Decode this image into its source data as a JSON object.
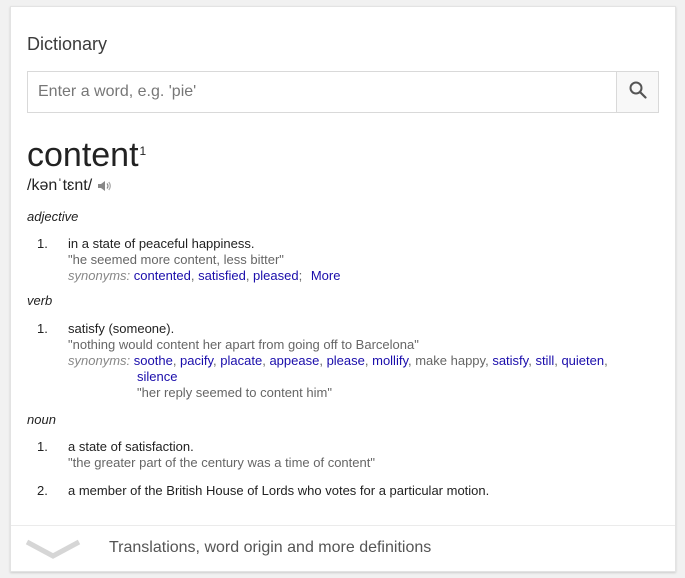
{
  "card": {
    "title": "Dictionary"
  },
  "search": {
    "placeholder": "Enter a word, e.g. 'pie'",
    "value": "",
    "icon": "search-icon"
  },
  "entry": {
    "word": "content",
    "superscript": "1",
    "pronunciation": "/kənˈtɛnt/",
    "speaker_icon": "speaker-icon"
  },
  "adjective": {
    "label": "adjective",
    "senses": [
      {
        "num": "1.",
        "definition": "in a state of peaceful happiness.",
        "example": "\"he seemed more content, less bitter\"",
        "synonyms_label": "synonyms:",
        "synonyms": [
          "contented",
          "satisfied",
          "pleased"
        ],
        "more": "More"
      }
    ]
  },
  "verb": {
    "label": "verb",
    "senses": [
      {
        "num": "1.",
        "definition": "satisfy (someone).",
        "example": "\"nothing would content her apart from going off to Barcelona\"",
        "synonyms_label": "synonyms:",
        "synonyms": [
          "soothe",
          "pacify",
          "placate",
          "appease",
          "please",
          "mollify",
          "make happy",
          "satisfy",
          "still",
          "quieten",
          "silence"
        ],
        "synonym_example": "\"her reply seemed to content him\""
      }
    ]
  },
  "noun": {
    "label": "noun",
    "senses": [
      {
        "num": "1.",
        "definition": "a state of satisfaction.",
        "example": "\"the greater part of the century was a time of content\""
      },
      {
        "num": "2.",
        "definition": "a member of the British House of Lords who votes for a particular motion."
      }
    ]
  },
  "footer": {
    "text": "Translations, word origin and more definitions",
    "icon": "chevron-down-icon"
  },
  "colors": {
    "link": "#1a0dab",
    "muted": "#666666",
    "label": "#878787"
  }
}
